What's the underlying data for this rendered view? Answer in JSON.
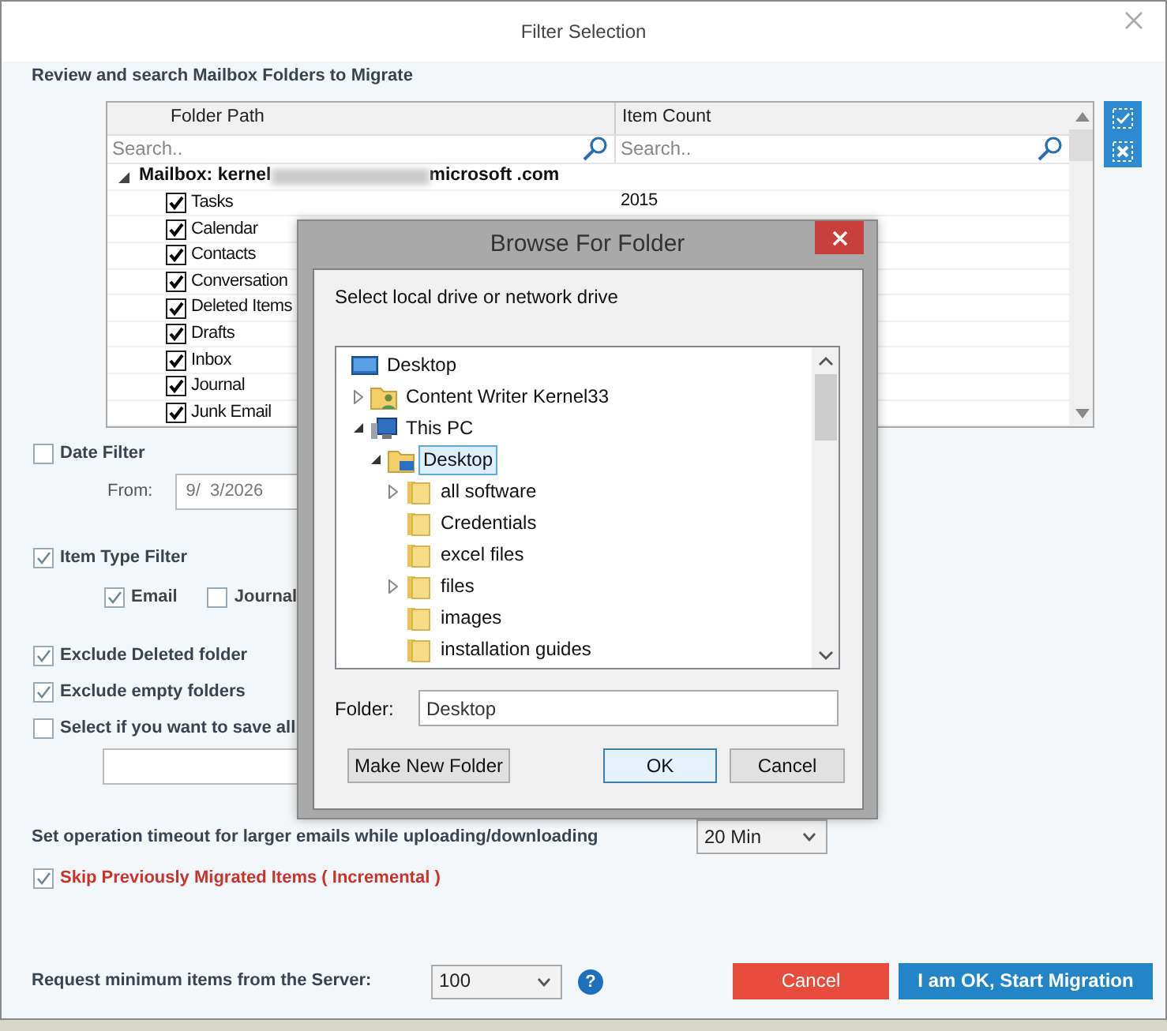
{
  "window": {
    "title": "Filter Selection"
  },
  "folders_section": {
    "heading": "Review and search Mailbox Folders to Migrate",
    "columns": [
      "Folder Path",
      "Item Count"
    ],
    "search": [
      {
        "placeholder": "Search.."
      },
      {
        "placeholder": "Search.."
      }
    ],
    "mailbox": {
      "label_start": "Mailbox: kernel",
      "label_end": "microsoft .com",
      "expanded": true,
      "folders": [
        {
          "name": "Tasks",
          "checked": true,
          "count": "2015"
        },
        {
          "name": "Calendar",
          "checked": true
        },
        {
          "name": "Contacts",
          "checked": true
        },
        {
          "name": "Conversation",
          "checked": true
        },
        {
          "name": "Deleted Items",
          "checked": true
        },
        {
          "name": "Drafts",
          "checked": true
        },
        {
          "name": "Inbox",
          "checked": true
        },
        {
          "name": "Journal",
          "checked": true
        },
        {
          "name": "Junk Email",
          "checked": true
        }
      ]
    }
  },
  "date_filter": {
    "label": "Date Filter",
    "checked": false,
    "from_label": "From:",
    "from_value": "9/  3/2026"
  },
  "item_type_filter": {
    "label": "Item Type Filter",
    "checked": true,
    "types": [
      {
        "label": "Email",
        "checked": true
      },
      {
        "label": "Journal",
        "checked": false
      }
    ]
  },
  "options": [
    {
      "label": "Exclude Deleted folder",
      "checked": true
    },
    {
      "label": "Exclude empty folders",
      "checked": true
    },
    {
      "label": "Select if you want to save all",
      "checked": false
    }
  ],
  "timeout": {
    "label": "Set operation timeout for larger emails while uploading/downloading",
    "value": "20 Min"
  },
  "incremental": {
    "label": "Skip Previously Migrated Items ( Incremental )",
    "checked": true
  },
  "min_items": {
    "label": "Request minimum items from the Server:",
    "value": "100",
    "help": "?"
  },
  "buttons": [
    {
      "label": "Cancel",
      "kind": "danger"
    },
    {
      "label": "I am OK, Start Migration",
      "kind": "primary"
    }
  ],
  "browse_dialog": {
    "title": "Browse For Folder",
    "prompt": "Select local drive or network drive",
    "tree": [
      {
        "label": "Desktop",
        "kind": "monitor",
        "selected": false,
        "children": [
          {
            "label": "Content Writer Kernel33",
            "kind": "user-folder",
            "expanded": false,
            "selected": false
          },
          {
            "label": "This PC",
            "kind": "pc",
            "expanded": true,
            "selected": false,
            "children": [
              {
                "label": "Desktop",
                "kind": "desktop-folder",
                "expanded": true,
                "selected": true,
                "children": [
                  {
                    "label": "all software",
                    "kind": "folder",
                    "expanded": false,
                    "selected": false
                  },
                  {
                    "label": "Credentials",
                    "kind": "folder",
                    "selected": false
                  },
                  {
                    "label": "excel files",
                    "kind": "folder",
                    "selected": false
                  },
                  {
                    "label": "files",
                    "kind": "folder",
                    "expanded": false,
                    "selected": false
                  },
                  {
                    "label": "images",
                    "kind": "folder",
                    "selected": false
                  },
                  {
                    "label": "installation guides",
                    "kind": "folder",
                    "selected": false
                  }
                ]
              }
            ]
          }
        ]
      }
    ],
    "folder_label": "Folder:",
    "folder_value": "Desktop",
    "buttons": [
      {
        "label": "Make New Folder",
        "default": false
      },
      {
        "label": "OK",
        "default": true
      },
      {
        "label": "Cancel",
        "default": false
      }
    ]
  }
}
